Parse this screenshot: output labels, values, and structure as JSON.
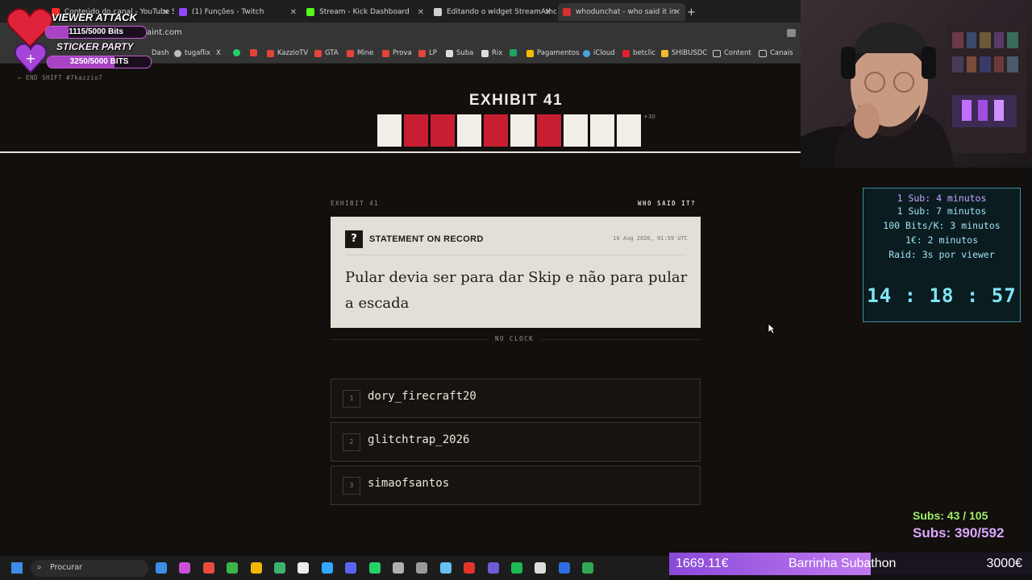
{
  "browser": {
    "tabs": [
      {
        "title": "Conteúdo do canal - YouTube St",
        "color": "#ff2b2b"
      },
      {
        "title": "(1) Funções - Twitch",
        "color": "#9146ff"
      },
      {
        "title": "Stream - Kick Dashboard",
        "color": "#53fc18"
      },
      {
        "title": "Editando o widget StreamAthon",
        "color": "#d0d0d0"
      },
      {
        "title": "whodunchat - who said it in",
        "color": "#d32f2f"
      }
    ],
    "new_tab": "+",
    "url": "aint.com",
    "bookmarks": [
      "Dash",
      "tugaflix",
      "X",
      "",
      "",
      "KazzioTV",
      "GTA",
      "Mine",
      "Prova",
      "LP",
      "Suba",
      "Rix",
      "Pagamentos",
      "iCloud",
      "betclic",
      "SHIBUSDC",
      "Content",
      "Canais"
    ]
  },
  "page": {
    "backlink": "← END SHIFT  #7kazzio7",
    "exhibit_title": "EXHIBIT 41",
    "strip": [
      "white",
      "red",
      "red",
      "white",
      "red",
      "white",
      "red",
      "white",
      "white",
      "white"
    ],
    "strip_more": "+30",
    "meta_left": "EXHIBIT 41",
    "meta_right": "WHO SAID IT?",
    "card": {
      "icon": "?",
      "label": "STATEMENT ON RECORD",
      "timestamp": "10 Aug 2026, 01:59 UTC",
      "statement": "Pular devia ser para dar Skip e não para pular a escada"
    },
    "no_clock": "NO CLOCK",
    "options": [
      {
        "num": "1",
        "name": "dory_firecraft20"
      },
      {
        "num": "2",
        "name": "glitchtrap_2026"
      },
      {
        "num": "3",
        "name": "simaofsantos"
      }
    ]
  },
  "overlay": {
    "viewer_attack": {
      "title": "VIEWER ATTACK",
      "bits1": "1115/5000 Bits",
      "bits1_progress": 0.223,
      "sticker_party": "STICKER PARTY",
      "bits2": "3250/5000 BITS",
      "bits2_progress": 0.65
    },
    "timer": {
      "lines": [
        "1 Sub: 4 minutos",
        "1 Sub: 7 minutos",
        "100 Bits/K: 3 minutos",
        "1€: 2 minutos",
        "Raid: 3s por viewer"
      ],
      "clock": "14 : 18 : 57"
    },
    "subs_line1": "Subs: 43 / 105",
    "subs_line2": "Subs: 390/592",
    "barrinha": {
      "left": "1669.11€",
      "label": "Barrinha Subathon",
      "right": "3000€",
      "progress": 0.556
    }
  },
  "taskbar": {
    "search_placeholder": "Procurar",
    "icons": [
      "#3a8ee6",
      "#c94fd6",
      "#e94b3c",
      "#39b54a",
      "#f2b600",
      "#3bb36e",
      "#eaeaea",
      "#31a8ff",
      "#5865f2",
      "#25d366",
      "#b0b0b0",
      "#9a9a9a",
      "#66c0f4",
      "#e1352b",
      "#6f5bd6",
      "#1db954",
      "#dddddd",
      "#2c6ee0",
      "#33a852"
    ]
  },
  "colors": {
    "red_cell": "#c81e32",
    "white_cell": "#f1eee8"
  }
}
